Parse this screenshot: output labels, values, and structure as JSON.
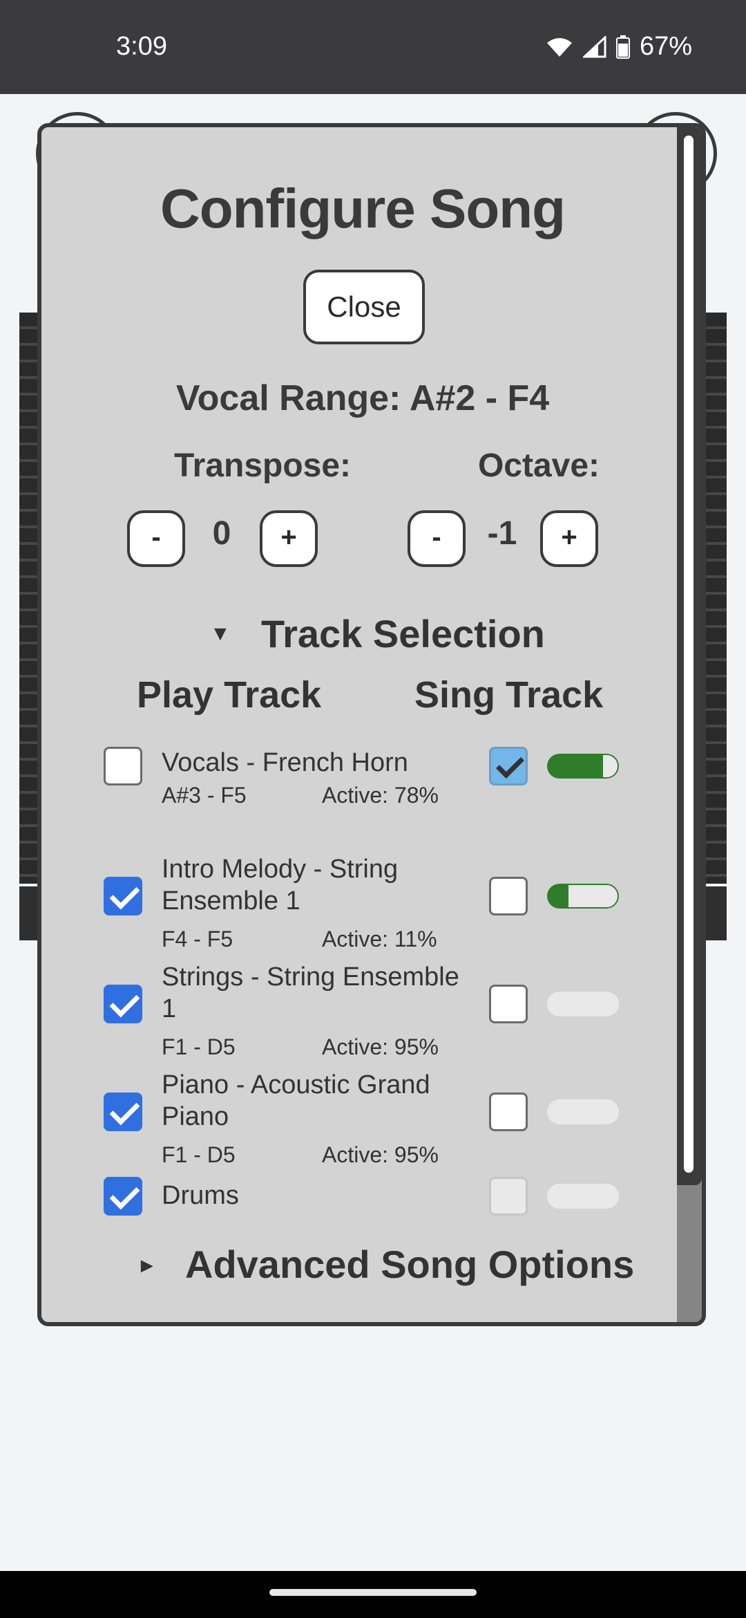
{
  "status": {
    "time": "3:09",
    "battery": "67%",
    "icons": [
      "wifi-icon",
      "signal-icon",
      "battery-icon"
    ]
  },
  "dialog": {
    "title": "Configure Song",
    "close_label": "Close",
    "vocal_range": "Vocal Range: A#2 - F4",
    "transpose": {
      "label": "Transpose:",
      "value": "0",
      "minus": "-",
      "plus": "+"
    },
    "octave": {
      "label": "Octave:",
      "value": "-1",
      "minus": "-",
      "plus": "+"
    },
    "track_selection": {
      "label": "Track Selection",
      "expanded": true
    },
    "columns": {
      "play": "Play Track",
      "sing": "Sing Track"
    },
    "tracks": [
      {
        "name": "Vocals - French Horn",
        "range": "A#3 - F5",
        "active": "Active: 78%",
        "play": false,
        "sing": true,
        "activity": 0.78
      },
      {
        "name": "Intro Melody - String Ensemble 1",
        "range": "F4 - F5",
        "active": "Active: 11%",
        "play": true,
        "sing": false,
        "activity": 0.11
      },
      {
        "name": "Strings - String Ensemble 1",
        "range": "F1 - D5",
        "active": "Active: 95%",
        "play": true,
        "sing": false,
        "activity": 0
      },
      {
        "name": "Piano - Acoustic Grand Piano",
        "range": "F1 - D5",
        "active": "Active: 95%",
        "play": true,
        "sing": false,
        "activity": 0
      },
      {
        "name": "Drums",
        "play": true,
        "sing": false,
        "sing_disabled": true,
        "activity": 0
      }
    ],
    "advanced": {
      "label": "Advanced Song Options",
      "expanded": false
    }
  },
  "colors": {
    "accent": "#2f6fe0",
    "activity": "#2f7d2a",
    "dialog_bg": "#d3d3d3",
    "border": "#3a3a3a"
  }
}
